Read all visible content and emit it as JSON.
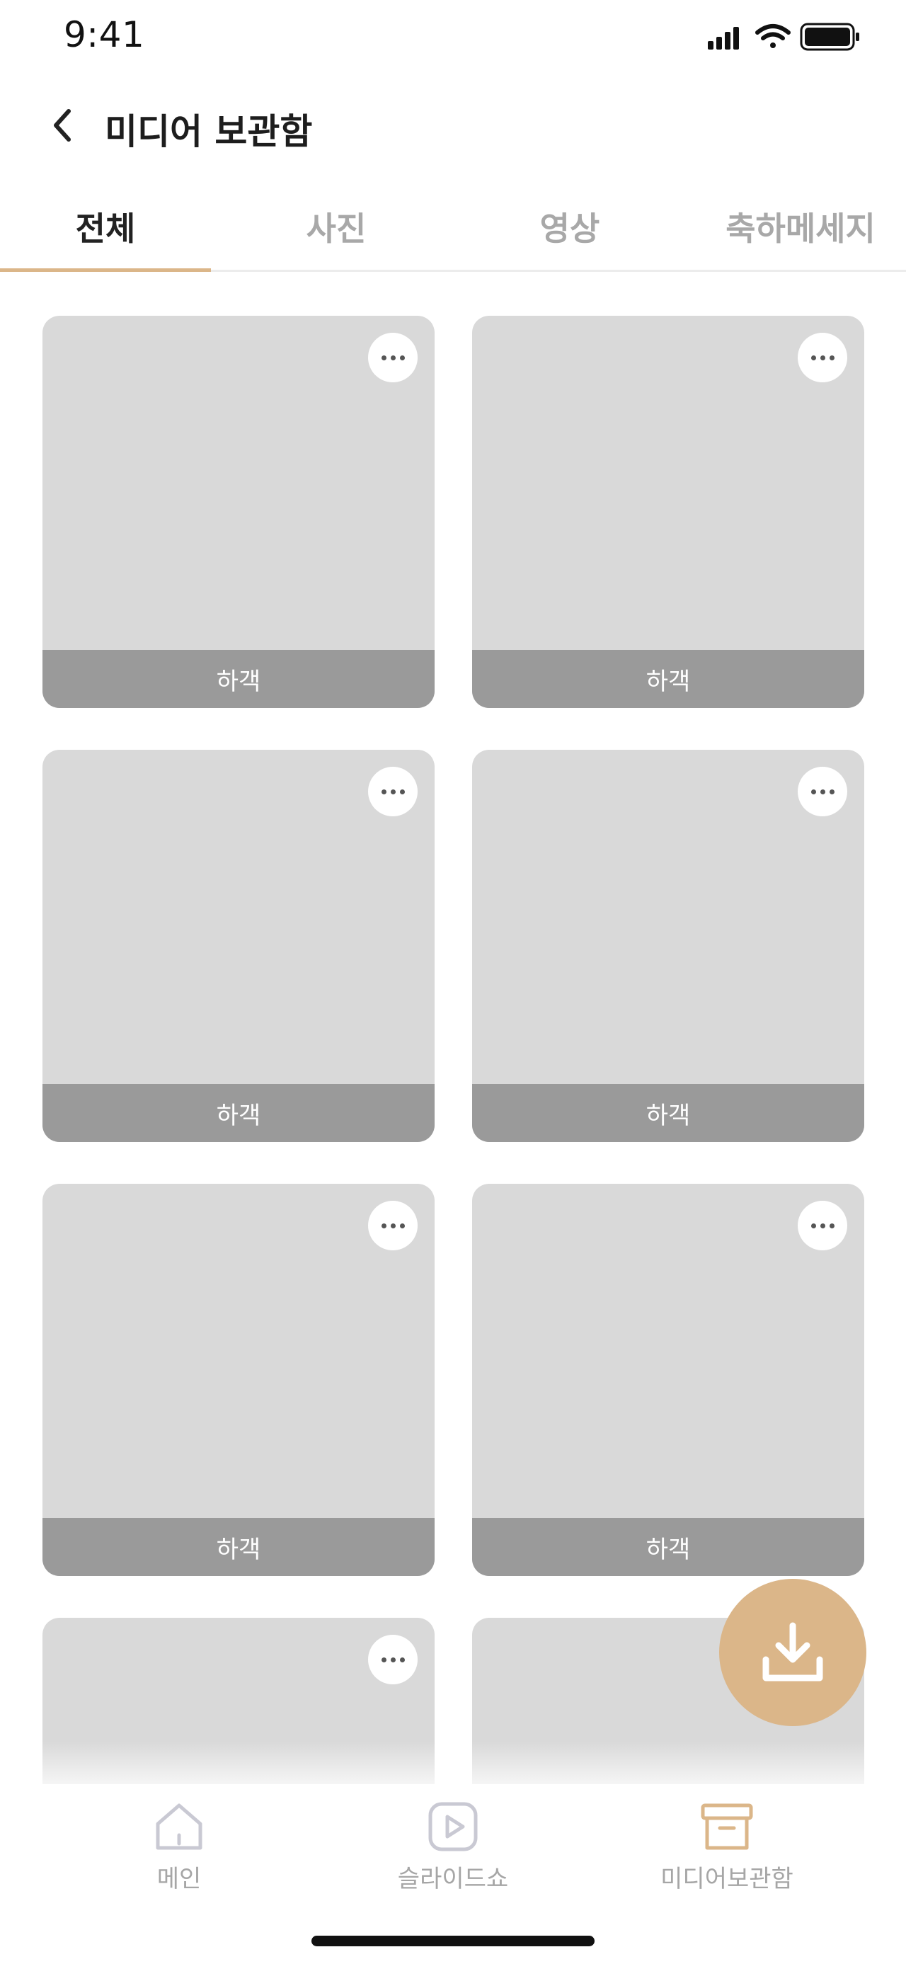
{
  "status_bar": {
    "time": "9:41"
  },
  "header": {
    "title": "미디어 보관함"
  },
  "tabs": [
    {
      "label": "전체",
      "active": true
    },
    {
      "label": "사진",
      "active": false
    },
    {
      "label": "영상",
      "active": false
    },
    {
      "label": "축하메세지",
      "active": false
    }
  ],
  "cards": [
    {
      "label": "하객"
    },
    {
      "label": "하객"
    },
    {
      "label": "하객"
    },
    {
      "label": "하객"
    },
    {
      "label": "하객"
    },
    {
      "label": "하객"
    }
  ],
  "bottom_nav": {
    "items": [
      {
        "label": "메인",
        "icon": "home-icon",
        "active": false
      },
      {
        "label": "슬라이드쇼",
        "icon": "play-icon",
        "active": false
      },
      {
        "label": "미디어보관함",
        "icon": "archive-icon",
        "active": true
      }
    ]
  },
  "fab": {
    "icon": "download-icon"
  },
  "colors": {
    "accent": "#dbb689",
    "card": "#d9d9d9",
    "card_label": "#9a9a9a",
    "inactive": "#a6a6a6"
  }
}
